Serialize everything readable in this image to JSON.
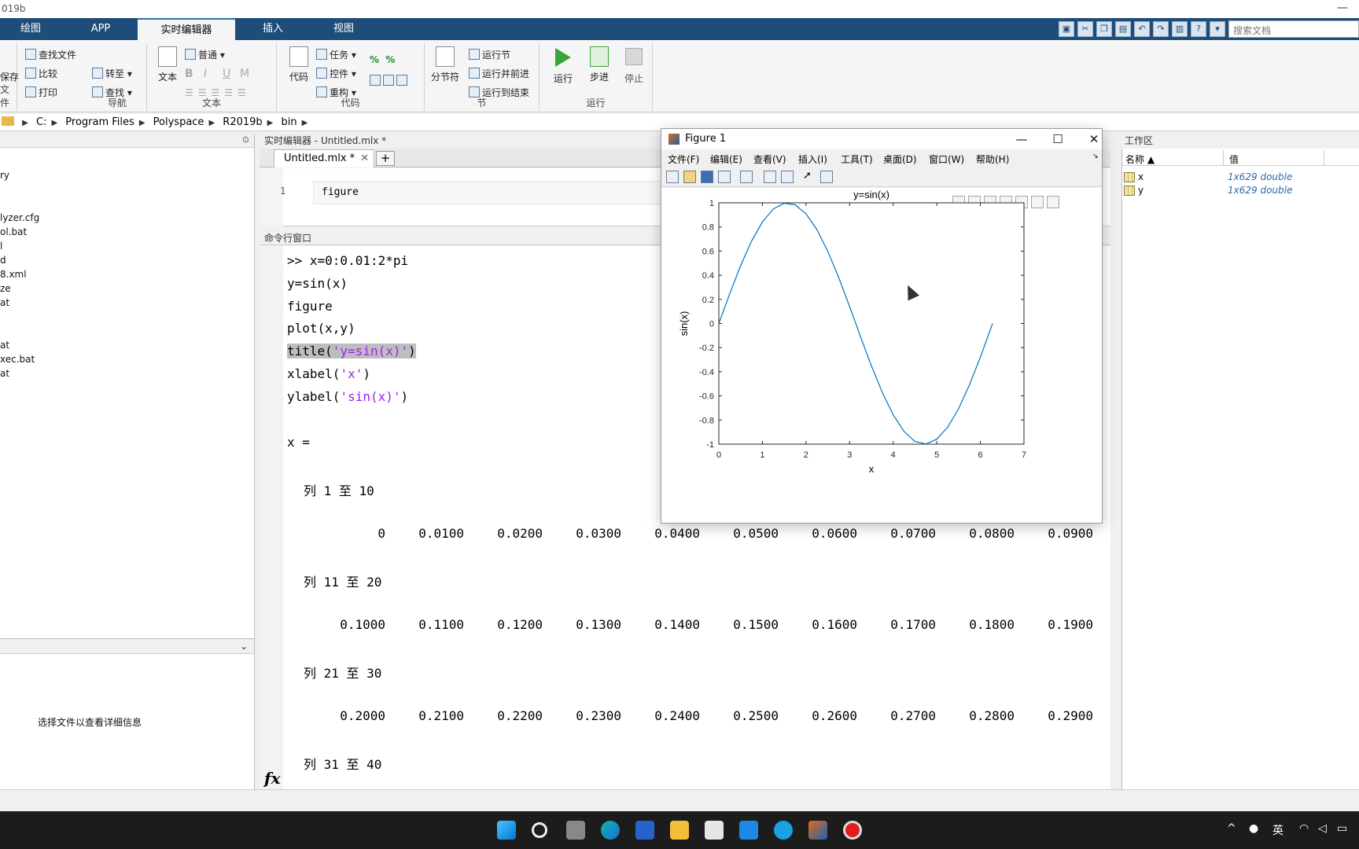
{
  "window": {
    "title": "019b",
    "minimize": "—"
  },
  "tabs": [
    "绘图",
    "APP",
    "实时编辑器",
    "插入",
    "视图"
  ],
  "search": {
    "placeholder": "搜索文档"
  },
  "ribbon": {
    "file": {
      "save": "保存",
      "label": "文件"
    },
    "nav": {
      "find_files": "查找文件",
      "compare": "比较",
      "print": "打印",
      "goto": "转至",
      "find": "查找",
      "label": "导航"
    },
    "text": {
      "text_btn": "文本",
      "style": "普通",
      "bold": "B",
      "italic": "I",
      "underline": "U",
      "mono": "M",
      "label": "文本"
    },
    "code": {
      "code_btn": "代码",
      "task": "任务",
      "control": "控件",
      "refactor": "重构",
      "label": "代码"
    },
    "section": {
      "section_break": "分节符",
      "run_section": "运行节",
      "run_advance": "运行并前进",
      "run_to_end": "运行到结束",
      "label": "节"
    },
    "run": {
      "run": "运行",
      "step": "步进",
      "stop": "停止",
      "label": "运行"
    }
  },
  "breadcrumb": [
    "C:",
    "Program Files",
    "Polyspace",
    "R2019b",
    "bin"
  ],
  "left_panel": {
    "files": [
      "ry",
      "",
      "",
      "lyzer.cfg",
      "ol.bat",
      "l",
      "d",
      "8.xml",
      "ze",
      "at",
      "",
      "",
      "at",
      "xec.bat",
      "at"
    ],
    "details_text": "选择文件以查看详细信息"
  },
  "editor": {
    "header": "实时编辑器 - Untitled.mlx *",
    "tab": "Untitled.mlx *",
    "close": "✕",
    "plus": "+",
    "line_no": "1",
    "code": "figure"
  },
  "command_window": {
    "header": "命令行窗口",
    "lines": [
      ">> x=0:0.01:2*pi",
      "y=sin(x)",
      "figure",
      "plot(x,y)"
    ],
    "title_cmd_pre": "title(",
    "title_cmd_str": "'y=sin(x)'",
    "title_cmd_post": ")",
    "xlabel_pre": "xlabel(",
    "xlabel_str": "'x'",
    "xlabel_post": ")",
    "ylabel_pre": "ylabel(",
    "ylabel_str": "'sin(x)'",
    "ylabel_post": ")",
    "x_eq": "x =",
    "col_headers": [
      "列 1 至 10",
      "列 11 至 20",
      "列 21 至 30",
      "列 31 至 40"
    ],
    "rows": [
      [
        "0",
        "0.0100",
        "0.0200",
        "0.0300",
        "0.0400",
        "0.0500",
        "0.0600",
        "0.0700",
        "0.0800",
        "0.0900"
      ],
      [
        "0.1000",
        "0.1100",
        "0.1200",
        "0.1300",
        "0.1400",
        "0.1500",
        "0.1600",
        "0.1700",
        "0.1800",
        "0.1900"
      ],
      [
        "0.2000",
        "0.2100",
        "0.2200",
        "0.2300",
        "0.2400",
        "0.2500",
        "0.2600",
        "0.2700",
        "0.2800",
        "0.2900"
      ]
    ],
    "fx": "fx"
  },
  "workspace": {
    "header": "工作区",
    "col_name": "名称 ▲",
    "col_value": "值",
    "vars": [
      {
        "name": "x",
        "value": "1x629 double"
      },
      {
        "name": "y",
        "value": "1x629 double"
      }
    ]
  },
  "figure": {
    "title": "Figure 1",
    "menu": [
      "文件(F)",
      "编辑(E)",
      "查看(V)",
      "插入(I)",
      "工具(T)",
      "桌面(D)",
      "窗口(W)",
      "帮助(H)"
    ],
    "btn_min": "—",
    "btn_max": "☐",
    "btn_close": "✕"
  },
  "chart_data": {
    "type": "line",
    "title": "y=sin(x)",
    "xlabel": "x",
    "ylabel": "sin(x)",
    "xlim": [
      0,
      7
    ],
    "ylim": [
      -1,
      1
    ],
    "xticks": [
      0,
      1,
      2,
      3,
      4,
      5,
      6,
      7
    ],
    "yticks": [
      1,
      0.8,
      0.6,
      0.4,
      0.2,
      0,
      -0.2,
      -0.4,
      -0.6,
      -0.8,
      -1
    ],
    "series": [
      {
        "color": "#0072bd",
        "x": [
          0,
          0.25,
          0.5,
          0.75,
          1,
          1.25,
          1.5,
          1.75,
          2,
          2.25,
          2.5,
          2.75,
          3,
          3.25,
          3.5,
          3.75,
          4,
          4.25,
          4.5,
          4.75,
          5,
          5.25,
          5.5,
          5.75,
          6,
          6.28
        ],
        "y": [
          0,
          0.247,
          0.479,
          0.682,
          0.841,
          0.949,
          0.997,
          0.984,
          0.909,
          0.778,
          0.598,
          0.382,
          0.141,
          -0.108,
          -0.351,
          -0.572,
          -0.757,
          -0.895,
          -0.978,
          -0.999,
          -0.959,
          -0.859,
          -0.706,
          -0.508,
          -0.279,
          0
        ]
      }
    ]
  },
  "taskbar": {
    "ime": "英"
  }
}
